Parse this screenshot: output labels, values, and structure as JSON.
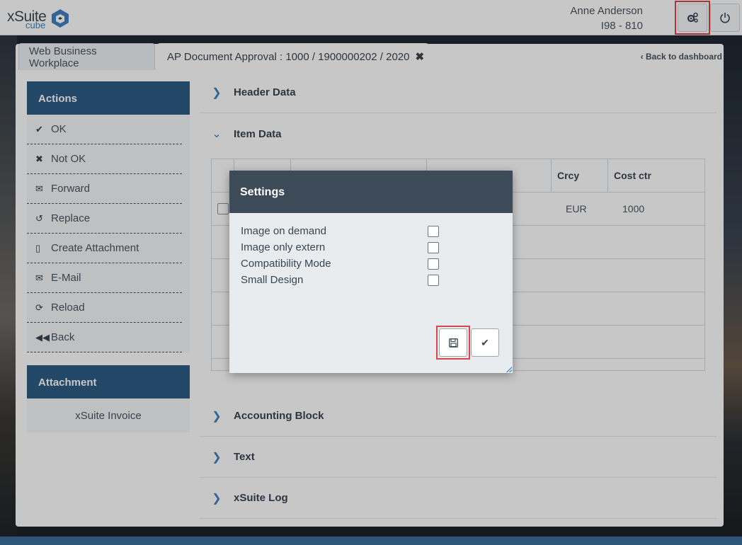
{
  "header": {
    "logo_text": "xSuite",
    "logo_sub": "cube",
    "user_name": "Anne Anderson",
    "user_system": "I98 - 810"
  },
  "tabs": [
    {
      "label": "Web Business Workplace"
    },
    {
      "label": "AP Document Approval : 1000 / 1900000202 / 2020"
    }
  ],
  "back_to_dashboard": "Back to dashboard",
  "actions": {
    "title": "Actions",
    "items": [
      {
        "label": "OK",
        "icon": "check-icon"
      },
      {
        "label": "Not OK",
        "icon": "x-icon"
      },
      {
        "label": "Forward",
        "icon": "envelope-icon"
      },
      {
        "label": "Replace",
        "icon": "undo-icon"
      },
      {
        "label": "Create Attachment",
        "icon": "pdf-file-icon"
      },
      {
        "label": "E-Mail",
        "icon": "envelope-icon"
      },
      {
        "label": "Reload",
        "icon": "refresh-icon"
      },
      {
        "label": "Back",
        "icon": "fast-backward-icon"
      }
    ]
  },
  "attachment": {
    "title": "Attachment",
    "item": "xSuite Invoice"
  },
  "sections": {
    "header_data": "Header Data",
    "item_data": "Item Data",
    "accounting_block": "Accounting Block",
    "text": "Text",
    "xsuite_log": "xSuite Log"
  },
  "table": {
    "columns": [
      "",
      "",
      "",
      "",
      "Crcy",
      "Cost ctr"
    ],
    "rows": [
      {
        "crcy": "EUR",
        "cost_ctr": "1000"
      }
    ]
  },
  "modal": {
    "title": "Settings",
    "options": [
      {
        "label": "Image on demand",
        "checked": false
      },
      {
        "label": "Image only extern",
        "checked": false
      },
      {
        "label": "Compatibility Mode",
        "checked": false
      },
      {
        "label": "Small Design",
        "checked": false
      }
    ]
  },
  "colors": {
    "primary": "#2d5b84",
    "modal_header": "#3d4a58",
    "highlight": "#d6464b"
  }
}
